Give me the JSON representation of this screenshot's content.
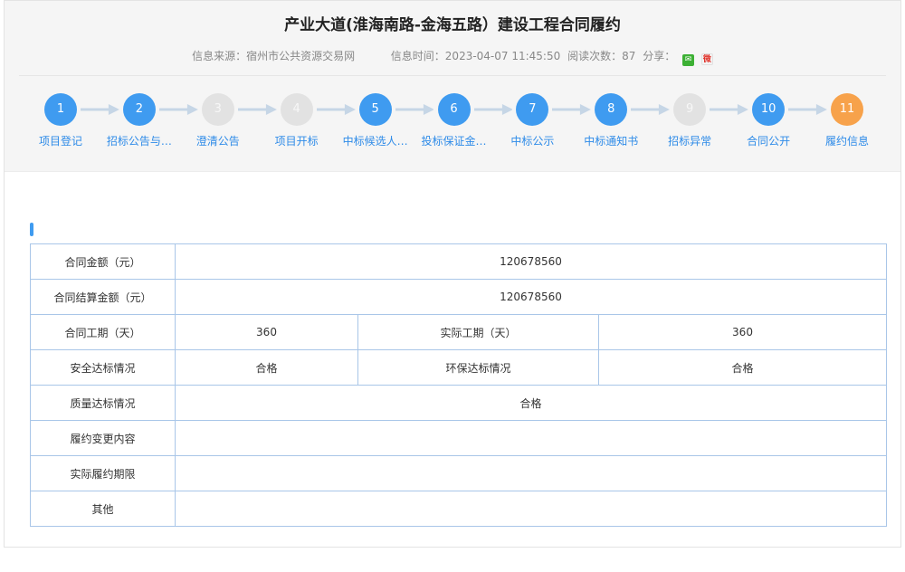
{
  "header": {
    "title": "产业大道(淮海南路-金海五路）建设工程合同履约",
    "source_label": "信息来源：宿州市公共资源交易网",
    "time_label": "信息时间：2023-04-07 11:45:50",
    "views_label": "阅读次数：87",
    "share_label": "分享：",
    "share_icons": [
      "wechat-icon",
      "weibo-icon"
    ]
  },
  "steps": [
    {
      "num": "1",
      "label": "项目登记",
      "status": "active"
    },
    {
      "num": "2",
      "label": "招标公告与…",
      "status": "active"
    },
    {
      "num": "3",
      "label": "澄清公告",
      "status": "inactive"
    },
    {
      "num": "4",
      "label": "项目开标",
      "status": "inactive"
    },
    {
      "num": "5",
      "label": "中标候选人…",
      "status": "active"
    },
    {
      "num": "6",
      "label": "投标保证金…",
      "status": "active"
    },
    {
      "num": "7",
      "label": "中标公示",
      "status": "active"
    },
    {
      "num": "8",
      "label": "中标通知书",
      "status": "active"
    },
    {
      "num": "9",
      "label": "招标异常",
      "status": "inactive"
    },
    {
      "num": "10",
      "label": "合同公开",
      "status": "active"
    },
    {
      "num": "11",
      "label": "履约信息",
      "status": "current"
    }
  ],
  "colors": {
    "step_active": "#3f9bf0",
    "step_inactive": "#e2e2e2",
    "step_current": "#f7a24b",
    "label": "#2e8be8",
    "table_border": "#a9c6e8"
  },
  "table": {
    "contract_amount": {
      "label": "合同金额（元）",
      "value": "120678560"
    },
    "settlement_amount": {
      "label": "合同结算金额（元）",
      "value": "120678560"
    },
    "contract_period": {
      "label": "合同工期（天）",
      "value": "360"
    },
    "actual_period": {
      "label": "实际工期（天）",
      "value": "360"
    },
    "safety": {
      "label": "安全达标情况",
      "value": "合格"
    },
    "environment": {
      "label": "环保达标情况",
      "value": "合格"
    },
    "quality": {
      "label": "质量达标情况",
      "value": "合格"
    },
    "change": {
      "label": "履约变更内容",
      "value": ""
    },
    "actual_term": {
      "label": "实际履约期限",
      "value": ""
    },
    "other": {
      "label": "其他",
      "value": ""
    }
  }
}
